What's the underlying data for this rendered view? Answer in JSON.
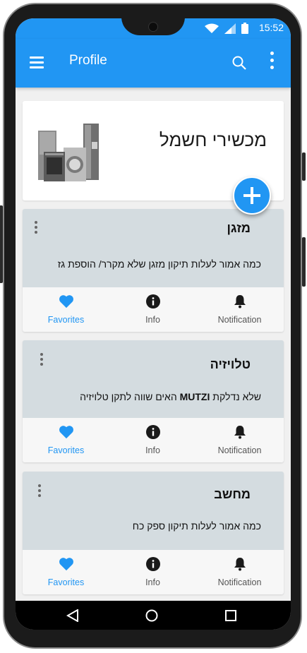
{
  "status_bar": {
    "time": "15:52"
  },
  "app_bar": {
    "title": "Profile",
    "menu_icon": "hamburger-icon",
    "search_icon": "search-icon",
    "more_icon": "more-vert-icon"
  },
  "header_card": {
    "title": "מכשירי חשמל",
    "image": "home-appliances-image"
  },
  "fab": {
    "icon": "add-icon"
  },
  "cards": [
    {
      "title": "מזגן",
      "text": "כמה אמור לעלות תיקון מזגן שלא מקרר/ הוספת גז",
      "actions": {
        "favorites": "Favorites",
        "info": "Info",
        "notification": "Notification"
      }
    },
    {
      "title": "טלויזיה",
      "text_before": "שלא נדלקת ",
      "text_bold": "MUTZI",
      "text_after": " האים שווה לתקן טלויזיה",
      "actions": {
        "favorites": "Favorites",
        "info": "Info",
        "notification": "Notification"
      }
    },
    {
      "title": "מחשב",
      "text": "כמה אמור לעלות תיקון ספק כח",
      "actions": {
        "favorites": "Favorites",
        "info": "Info",
        "notification": "Notification"
      }
    }
  ],
  "colors": {
    "primary": "#2196f3",
    "card_bg": "#d4dce0",
    "actions_bg": "#f7f7f7"
  }
}
